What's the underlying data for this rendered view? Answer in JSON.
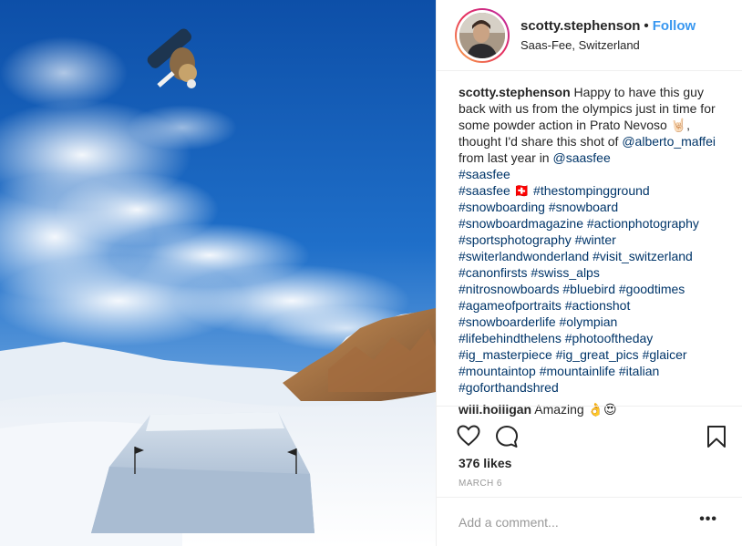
{
  "post": {
    "username": "scotty.stephenson",
    "follow_label": "Follow",
    "separator": "•",
    "location": "Saas-Fee, Switzerland"
  },
  "caption": {
    "username": "scotty.stephenson",
    "text_part1": " Happy to have this guy back with us from the olympics just in time for some powder action in Prato Nevoso 🤘🏻, thought I'd share this shot of ",
    "mention1": "@alberto_maffei",
    "text_part2": " from last year in ",
    "mention2": "@saasfee",
    "lines": [
      "#saasfee",
      "#saasfee 🇨🇭 #thestompingground",
      "#snowboarding #snowboard",
      "#snowboardmagazine #actionphotography",
      "#sportsphotography #winter",
      "#switerlandwonderland #visit_switzerland",
      "#canonfirsts #swiss_alps",
      "#nitrosnowboards #bluebird #goodtimes",
      "#agameofportraits #actionshot",
      "#snowboarderlife #olympian",
      "#lifebehindthelens #photooftheday",
      "#ig_masterpiece #ig_great_pics #glaicer",
      "#mountaintop #mountainlife #italian",
      "#goforthandshred"
    ]
  },
  "comment": {
    "username": "will.holligan",
    "text": " Amazing 👌😍"
  },
  "actions": {
    "like_icon": "heart-icon",
    "comment_icon": "speech-bubble-icon",
    "save_icon": "bookmark-icon"
  },
  "likes": "376 likes",
  "date": "MARCH 6",
  "comment_box": {
    "placeholder": "Add a comment...",
    "more": "•••"
  },
  "colors": {
    "link": "#003569",
    "follow": "#3897f0",
    "muted": "#999999"
  }
}
